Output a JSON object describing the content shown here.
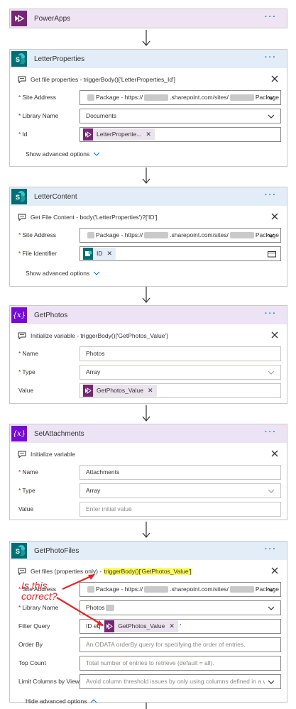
{
  "cards": {
    "powerapps": {
      "title": "PowerApps",
      "icon": "powerapps-icon"
    },
    "letter_properties": {
      "title": "LetterProperties",
      "icon": "sharepoint-icon",
      "action": "Get file properties - triggerBody()['LetterProperties_Id']",
      "fields": [
        {
          "label": "Site Address",
          "required": true,
          "value_prefix": "Package - https://",
          "value_mid": ".sharepoint.com/sites/",
          "value_suffix": "Package",
          "type": "dropdown"
        },
        {
          "label": "Library Name",
          "required": true,
          "value": "Documents",
          "type": "dropdown"
        },
        {
          "label": "Id",
          "required": true,
          "token": "LetterPropertie...",
          "type": "token"
        }
      ],
      "advanced": "Show advanced options"
    },
    "letter_content": {
      "title": "LetterContent",
      "icon": "sharepoint-icon",
      "action": "Get File Content - body('LetterProperties')?['ID']",
      "fields": [
        {
          "label": "Site Address",
          "required": true,
          "value_prefix": "Package - https://",
          "value_mid": ".sharepoint.com/sites/",
          "value_suffix": "Package"
        },
        {
          "label": "File Identifier",
          "required": true,
          "token": "ID"
        }
      ],
      "advanced": "Show advanced options"
    },
    "get_photos": {
      "title": "GetPhotos",
      "icon": "variable-icon",
      "action": "Initialize variable - triggerBody()['GetPhotos_Value']",
      "fields": [
        {
          "label": "Name",
          "required": true,
          "value": "Photos"
        },
        {
          "label": "Type",
          "required": true,
          "value": "Array"
        },
        {
          "label": "Value",
          "required": false,
          "token": "GetPhotos_Value"
        }
      ]
    },
    "set_attachments": {
      "title": "SetAttachments",
      "icon": "variable-icon",
      "action": "Initialize variable",
      "fields": [
        {
          "label": "Name",
          "required": true,
          "value": "Attachments"
        },
        {
          "label": "Type",
          "required": true,
          "value": "Array"
        },
        {
          "label": "Value",
          "required": false,
          "placeholder": "Enter initial value"
        }
      ]
    },
    "get_photo_files": {
      "title": "GetPhotoFiles",
      "icon": "sharepoint-icon",
      "action_prefix": "Get files (properties only) - ",
      "action_highlight": "triggerBody()['GetPhotos_Value']",
      "fields": [
        {
          "label": "Site Address",
          "required": true,
          "value_prefix": "Package - https://",
          "value_mid": ".sharepoint.com/sites/",
          "value_suffix": "Package"
        },
        {
          "label": "Library Name",
          "required": true,
          "value": "Photos"
        },
        {
          "label": "Filter Query",
          "required": false,
          "value_prefix": "ID eq '",
          "token": "GetPhotos_Value",
          "value_suffix": "'"
        },
        {
          "label": "Order By",
          "required": false,
          "placeholder": "An ODATA orderBy query for specifying the order of entries."
        },
        {
          "label": "Top Count",
          "required": false,
          "placeholder": "Total number of entries to retrieve (default = all)."
        },
        {
          "label": "Limit Columns by View",
          "required": false,
          "placeholder": "Avoid column threshold issues by only using columns defined in a view"
        }
      ],
      "advanced": "Hide advanced options"
    }
  },
  "annotation": {
    "line1": "Is this",
    "line2": "correct?"
  },
  "more_label": "···",
  "colors": {
    "accent": "#0078d4",
    "annotation": "#e8242a",
    "highlight": "#ffff5a"
  }
}
